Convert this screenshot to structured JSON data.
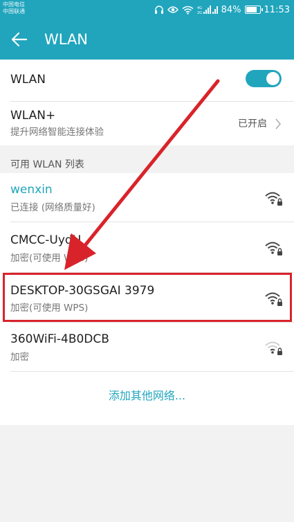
{
  "status_bar": {
    "carrier_1": "中国电信",
    "carrier_2": "中国联通",
    "battery_text": "84%",
    "battery_level": 0.84,
    "time": "11:53",
    "icons": [
      "headset-icon",
      "eye-icon",
      "wifi-status-icon",
      "signal-icon",
      "battery-icon"
    ]
  },
  "header": {
    "title": "WLAN"
  },
  "wlan_toggle": {
    "label": "WLAN",
    "on": true
  },
  "wlan_plus": {
    "title": "WLAN+",
    "subtitle": "提升网络智能连接体验",
    "status": "已开启"
  },
  "section": {
    "header": "可用 WLAN 列表"
  },
  "networks": [
    {
      "name": "wenxin",
      "status": "已连接 (网络质量好)",
      "connected": true,
      "signal": "strong"
    },
    {
      "name": "CMCC-UydU",
      "status": "加密(可使用 WPS)",
      "connected": false,
      "signal": "strong"
    },
    {
      "name": "DESKTOP-30GSGAI 3979",
      "status": "加密(可使用 WPS)",
      "connected": false,
      "signal": "strong",
      "highlighted": true
    },
    {
      "name": "360WiFi-4B0DCB",
      "status": "加密",
      "connected": false,
      "signal": "weak"
    }
  ],
  "add_network": "添加其他网络...",
  "colors": {
    "accent": "#21a5bd",
    "highlight": "#d9232a",
    "background": "#f2f2f2"
  }
}
